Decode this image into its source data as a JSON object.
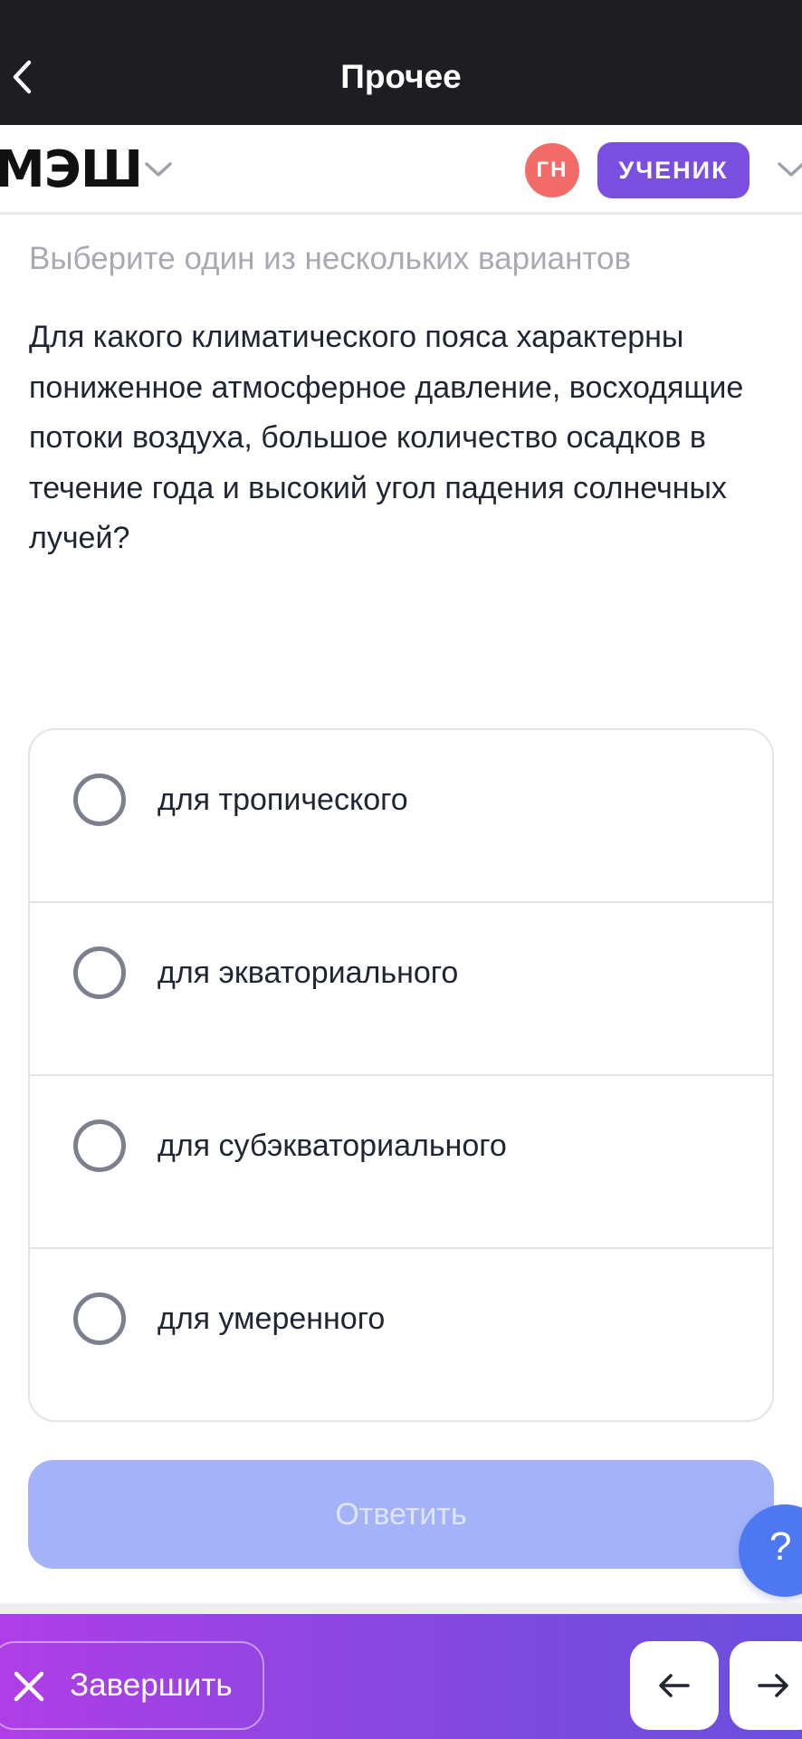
{
  "navbar": {
    "title": "Прочее",
    "back_icon": "chevron-left-icon"
  },
  "header": {
    "logo_text": "МЭШ",
    "user_initials": "ГН",
    "role_label": "УЧЕНИК",
    "colors": {
      "avatar": "#f26b67",
      "role_badge": "#7a4fe0"
    }
  },
  "question": {
    "instruction": "Выберите один из нескольких вариантов",
    "text": "Для какого климатического пояса характерны пониженное атмосферное давление, восходящие потоки воздуха, большое количество осадков в течение года и высокий угол падения солнечных лучей?"
  },
  "options": [
    {
      "label": "для тропического"
    },
    {
      "label": "для экваториального"
    },
    {
      "label": "для субэкваториального"
    },
    {
      "label": "для умеренного"
    }
  ],
  "submit": {
    "label": "Ответить",
    "color": "#a4b3f8"
  },
  "help": {
    "label": "?",
    "color": "#4d78f2"
  },
  "bottom_bar": {
    "finish_label": "Завершить",
    "prev_label": "←",
    "next_label": "→"
  }
}
